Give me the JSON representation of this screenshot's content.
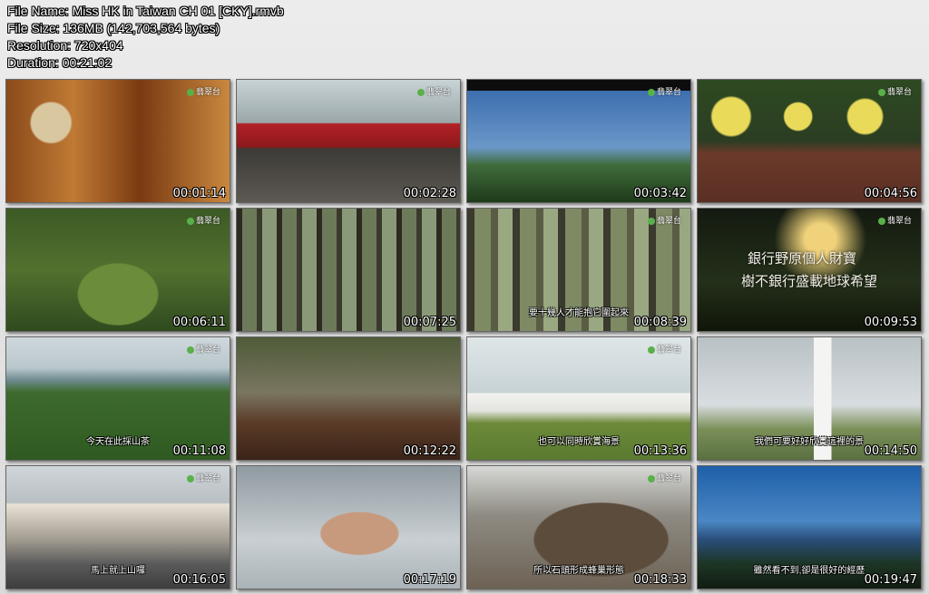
{
  "file_info": {
    "file_name": "File Name: Miss HK in Taiwan CH 01 [CKY].rmvb",
    "file_size": "File Size: 136MB (142,703,564 bytes)",
    "resolution": "Resolution: 720x404",
    "duration": "Duration: 00:21:02"
  },
  "channel_logo": "翡翠台",
  "thumbnails": [
    {
      "time": "00:01:14",
      "scene": "travel-book",
      "caption": "",
      "overlay": "",
      "overlay2": "",
      "logo": true
    },
    {
      "time": "00:02:28",
      "scene": "red-train",
      "caption": "",
      "overlay": "",
      "overlay2": "",
      "logo": true
    },
    {
      "time": "00:03:42",
      "scene": "blue-sky-trees",
      "caption": "",
      "overlay": "",
      "overlay2": "",
      "logo": true
    },
    {
      "time": "00:04:56",
      "scene": "umbrellas",
      "caption": "",
      "overlay": "",
      "overlay2": "",
      "logo": true
    },
    {
      "time": "00:06:11",
      "scene": "green-garden",
      "caption": "",
      "overlay": "",
      "overlay2": "",
      "logo": true
    },
    {
      "time": "00:07:25",
      "scene": "tall-forest",
      "caption": "",
      "overlay": "",
      "overlay2": "",
      "logo": false
    },
    {
      "time": "00:08:39",
      "scene": "forest-group",
      "caption": "要十幾人才能抱它圍起來",
      "overlay": "",
      "overlay2": "",
      "logo": true
    },
    {
      "time": "00:09:53",
      "scene": "dark-trees-text",
      "caption": "",
      "overlay": "銀行野原個人財寶",
      "overlay2": "樹不銀行盛載地球希望",
      "logo": true
    },
    {
      "time": "00:11:08",
      "scene": "tea-field",
      "caption": "今天在此採山茶",
      "overlay": "",
      "overlay2": "",
      "logo": true
    },
    {
      "time": "00:12:22",
      "scene": "tea-drinking",
      "caption": "",
      "overlay": "",
      "overlay2": "",
      "logo": false
    },
    {
      "time": "00:13:36",
      "scene": "white-building",
      "caption": "也可以同時欣賞海景",
      "overlay": "",
      "overlay2": "",
      "logo": true
    },
    {
      "time": "00:14:50",
      "scene": "lighthouse",
      "caption": "我們可要好好欣賞這裡的景",
      "overlay": "",
      "overlay2": "",
      "logo": false
    },
    {
      "time": "00:16:05",
      "scene": "street-pink",
      "caption": "馬上就上山囉",
      "overlay": "",
      "overlay2": "",
      "logo": true
    },
    {
      "time": "00:17:19",
      "scene": "bikini",
      "caption": "",
      "overlay": "",
      "overlay2": "",
      "logo": false
    },
    {
      "time": "00:18:33",
      "scene": "rock-coast",
      "caption": "所以石頭形成蜂巢形態",
      "overlay": "",
      "overlay2": "",
      "logo": true
    },
    {
      "time": "00:19:47",
      "scene": "sea-trees",
      "caption": "雖然看不到,卻是很好的經歷",
      "overlay": "",
      "overlay2": "",
      "logo": false
    }
  ]
}
